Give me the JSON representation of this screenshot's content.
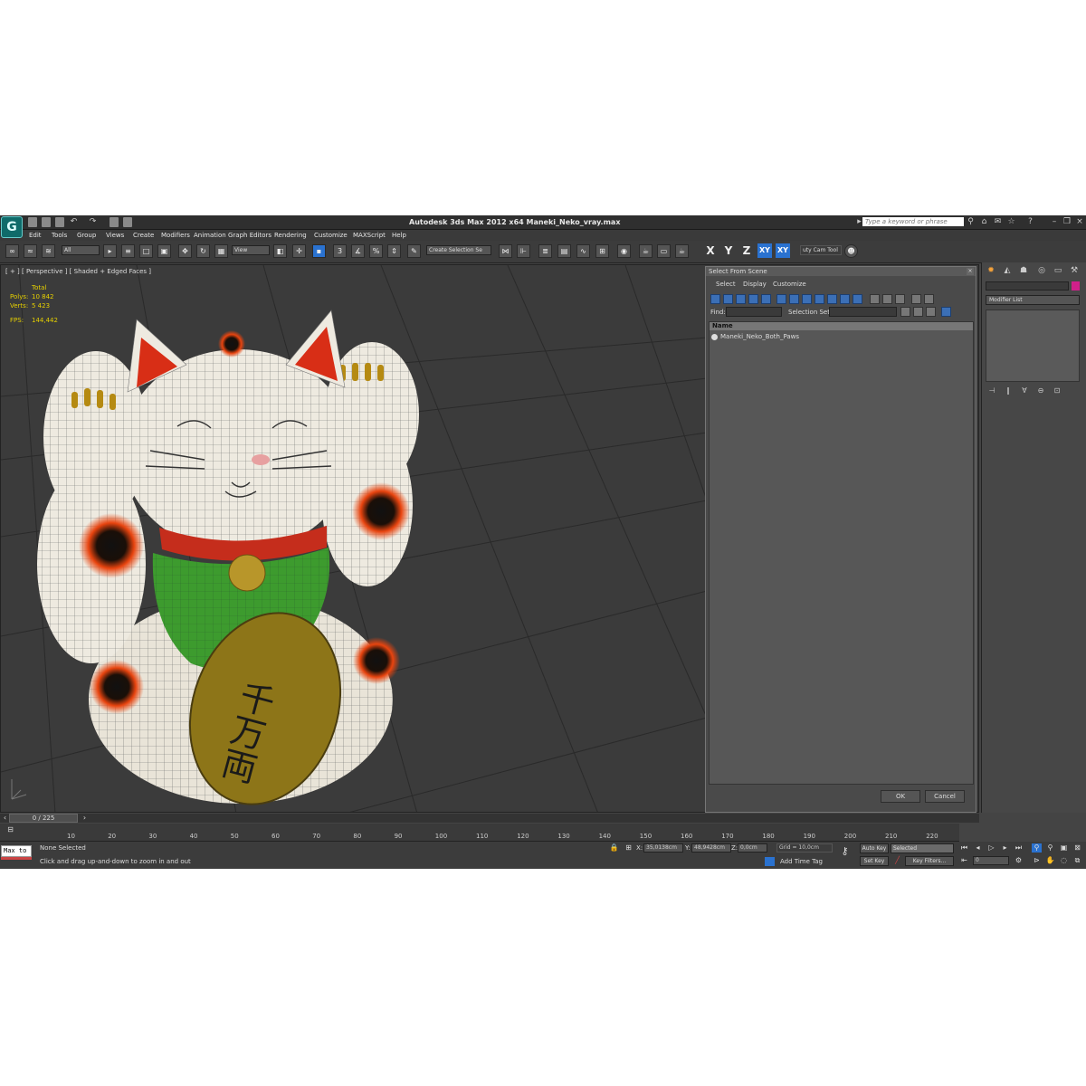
{
  "app": {
    "title": "Autodesk 3ds Max  2012 x64     Maneki_Neko_vray.max",
    "search_placeholder": "Type a keyword or phrase"
  },
  "menu": [
    "Edit",
    "Tools",
    "Group",
    "Views",
    "Create",
    "Modifiers",
    "Animation",
    "Graph Editors",
    "Rendering",
    "Customize",
    "MAXScript",
    "Help"
  ],
  "toolbar": {
    "filter_value": "All",
    "view_dropdown": "View",
    "selection_set": "Create Selection Se",
    "axis_x": "X",
    "axis_y": "Y",
    "axis_z": "Z",
    "axis_xy": "XY",
    "axis_xy2": "XY",
    "caddy": "uty Cam Tool"
  },
  "viewport": {
    "label": "[ + ] [ Perspective ] [ Shaded + Edged Faces ]",
    "stats": {
      "total_label": "Total",
      "polys_label": "Polys:",
      "polys_value": "10 842",
      "verts_label": "Verts:",
      "verts_value": "5 423",
      "fps_label": "FPS:",
      "fps_value": "144,442"
    },
    "coin_text": "千万両"
  },
  "dialog": {
    "title": "Select From Scene",
    "menu": [
      "Select",
      "Display",
      "Customize"
    ],
    "find_label": "Find:",
    "selection_set_label": "Selection Set:",
    "column_header": "Name",
    "items": [
      "Maneki_Neko_Both_Paws"
    ],
    "ok": "OK",
    "cancel": "Cancel"
  },
  "command_panel": {
    "modifier_list": "Modifier List",
    "object_color": "#d0208a"
  },
  "timeline": {
    "frame": "0 / 225",
    "ticks": [
      "10",
      "20",
      "30",
      "40",
      "50",
      "60",
      "70",
      "80",
      "90",
      "100",
      "110",
      "120",
      "130",
      "140",
      "150",
      "160",
      "170",
      "180",
      "190",
      "200",
      "210",
      "220"
    ]
  },
  "status": {
    "maxscript": "Max to",
    "selection": "None Selected",
    "prompt": "Click and drag up-and-down to zoom in and out",
    "x_label": "X:",
    "x_value": "35,0138cm",
    "y_label": "Y:",
    "y_value": "48,9428cm",
    "z_label": "Z:",
    "z_value": "0,0cm",
    "grid": "Grid = 10,0cm",
    "add_time_tag": "Add Time Tag",
    "auto_key": "Auto Key",
    "selected": "Selected",
    "set_key": "Set Key",
    "key_filters": "Key Filters...",
    "frame_value": "0"
  },
  "colors": {
    "app_bg": "#444444",
    "accent_blue": "#2a72d0",
    "stats_yellow": "#e6d000"
  }
}
